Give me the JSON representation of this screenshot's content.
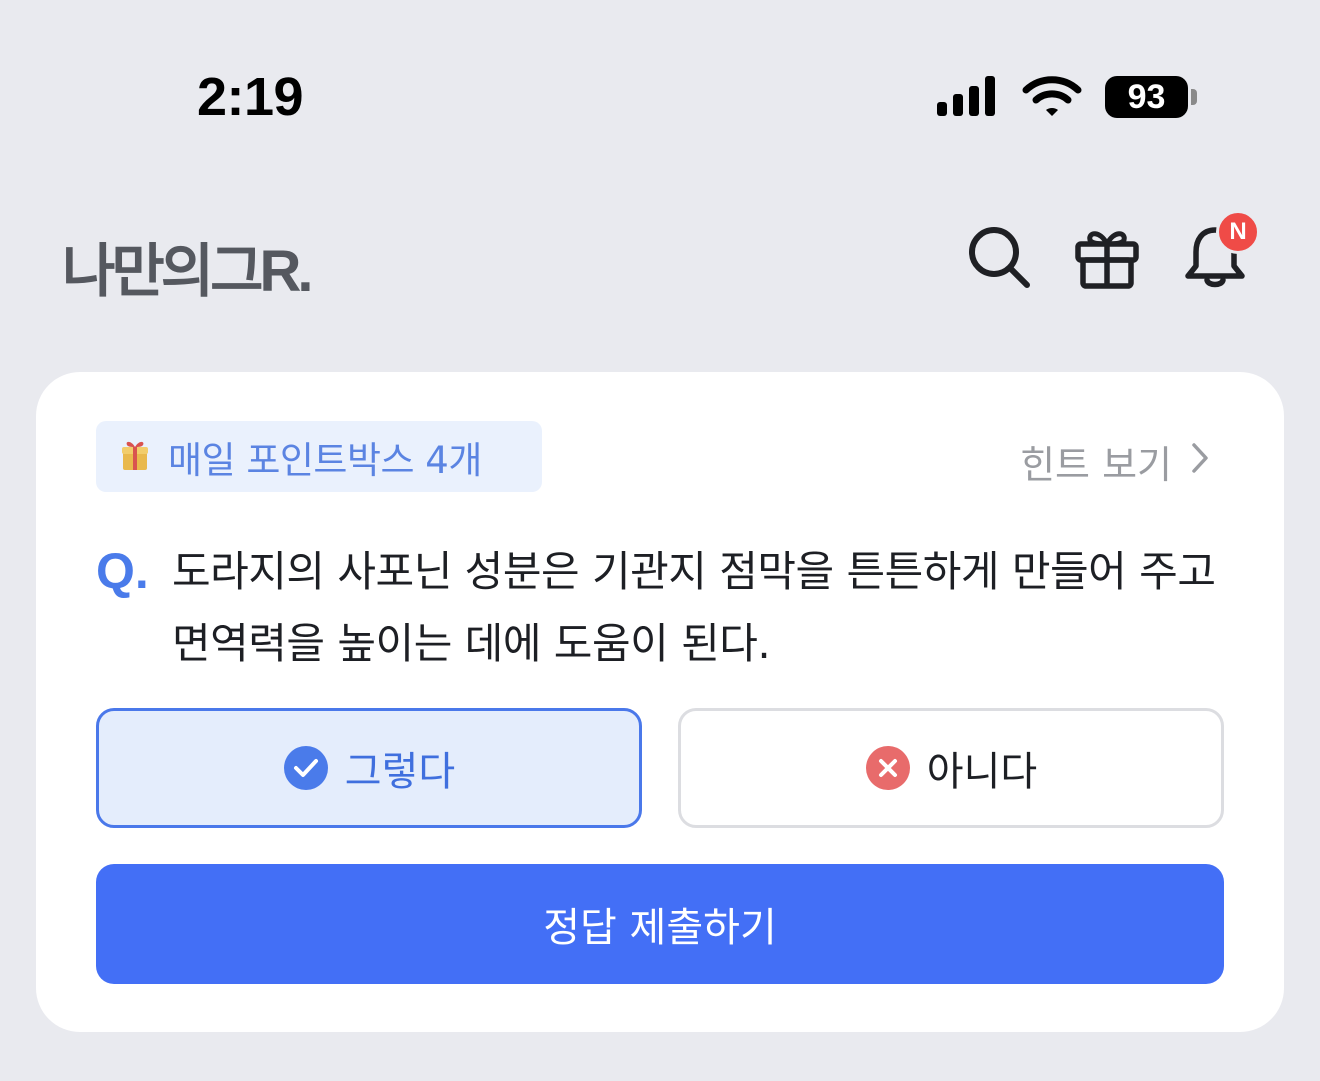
{
  "status_bar": {
    "time": "2:19",
    "battery": "93"
  },
  "header": {
    "logo": "나만의그R.",
    "notification_badge": "N",
    "icons": [
      "search-icon",
      "gift-icon",
      "bell-icon"
    ]
  },
  "quiz": {
    "pointbox_icon": "gift-box-icon",
    "pointbox_label": "매일 포인트박스 4개",
    "hint_label": "힌트 보기",
    "question_mark": "Q.",
    "question_text": "도라지의 사포닌 성분은 기관지 점막을 튼튼하게 만들어 주고 면역력을 높이는 데에 도움이 된다.",
    "choices": [
      {
        "label": "그렇다",
        "icon": "check-circle-icon",
        "selected": true
      },
      {
        "label": "아니다",
        "icon": "x-circle-icon",
        "selected": false
      }
    ],
    "submit_label": "정답 제출하기"
  },
  "colors": {
    "accent": "#436ff6",
    "selected_bg": "#e4edfc",
    "badge": "#ef4b47",
    "wrong_icon": "#e86b6b"
  }
}
